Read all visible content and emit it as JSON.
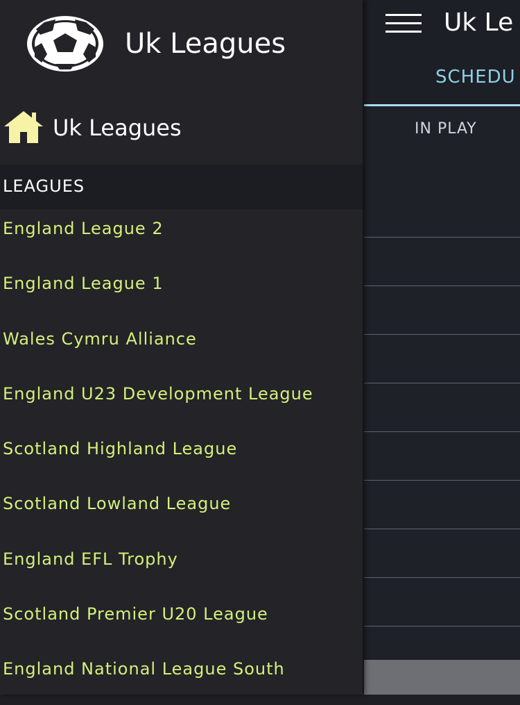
{
  "app": {
    "title": "Uk Le",
    "tabs": [
      "SCHEDU"
    ],
    "inplay_label": "IN PLAY"
  },
  "drawer": {
    "title": "Uk Leagues",
    "home_label": "Uk Leagues",
    "section_label": "LEAGUES",
    "leagues": [
      "England League 2",
      "England League 1",
      "Wales Cymru Alliance",
      "England U23 Development League",
      "Scotland Highland League",
      "Scotland Lowland League",
      "England EFL Trophy",
      "Scotland Premier U20 League",
      "England National League South"
    ]
  },
  "icons": {
    "menu": "hamburger-menu-icon",
    "ball": "soccer-ball-icon",
    "home": "home-icon"
  },
  "colors": {
    "drawer_bg": "#232328",
    "section_bg": "#1b1d22",
    "league_text": "#d4f07a",
    "tab_accent": "#8fd0e6",
    "home_icon": "#f6f3a6"
  }
}
